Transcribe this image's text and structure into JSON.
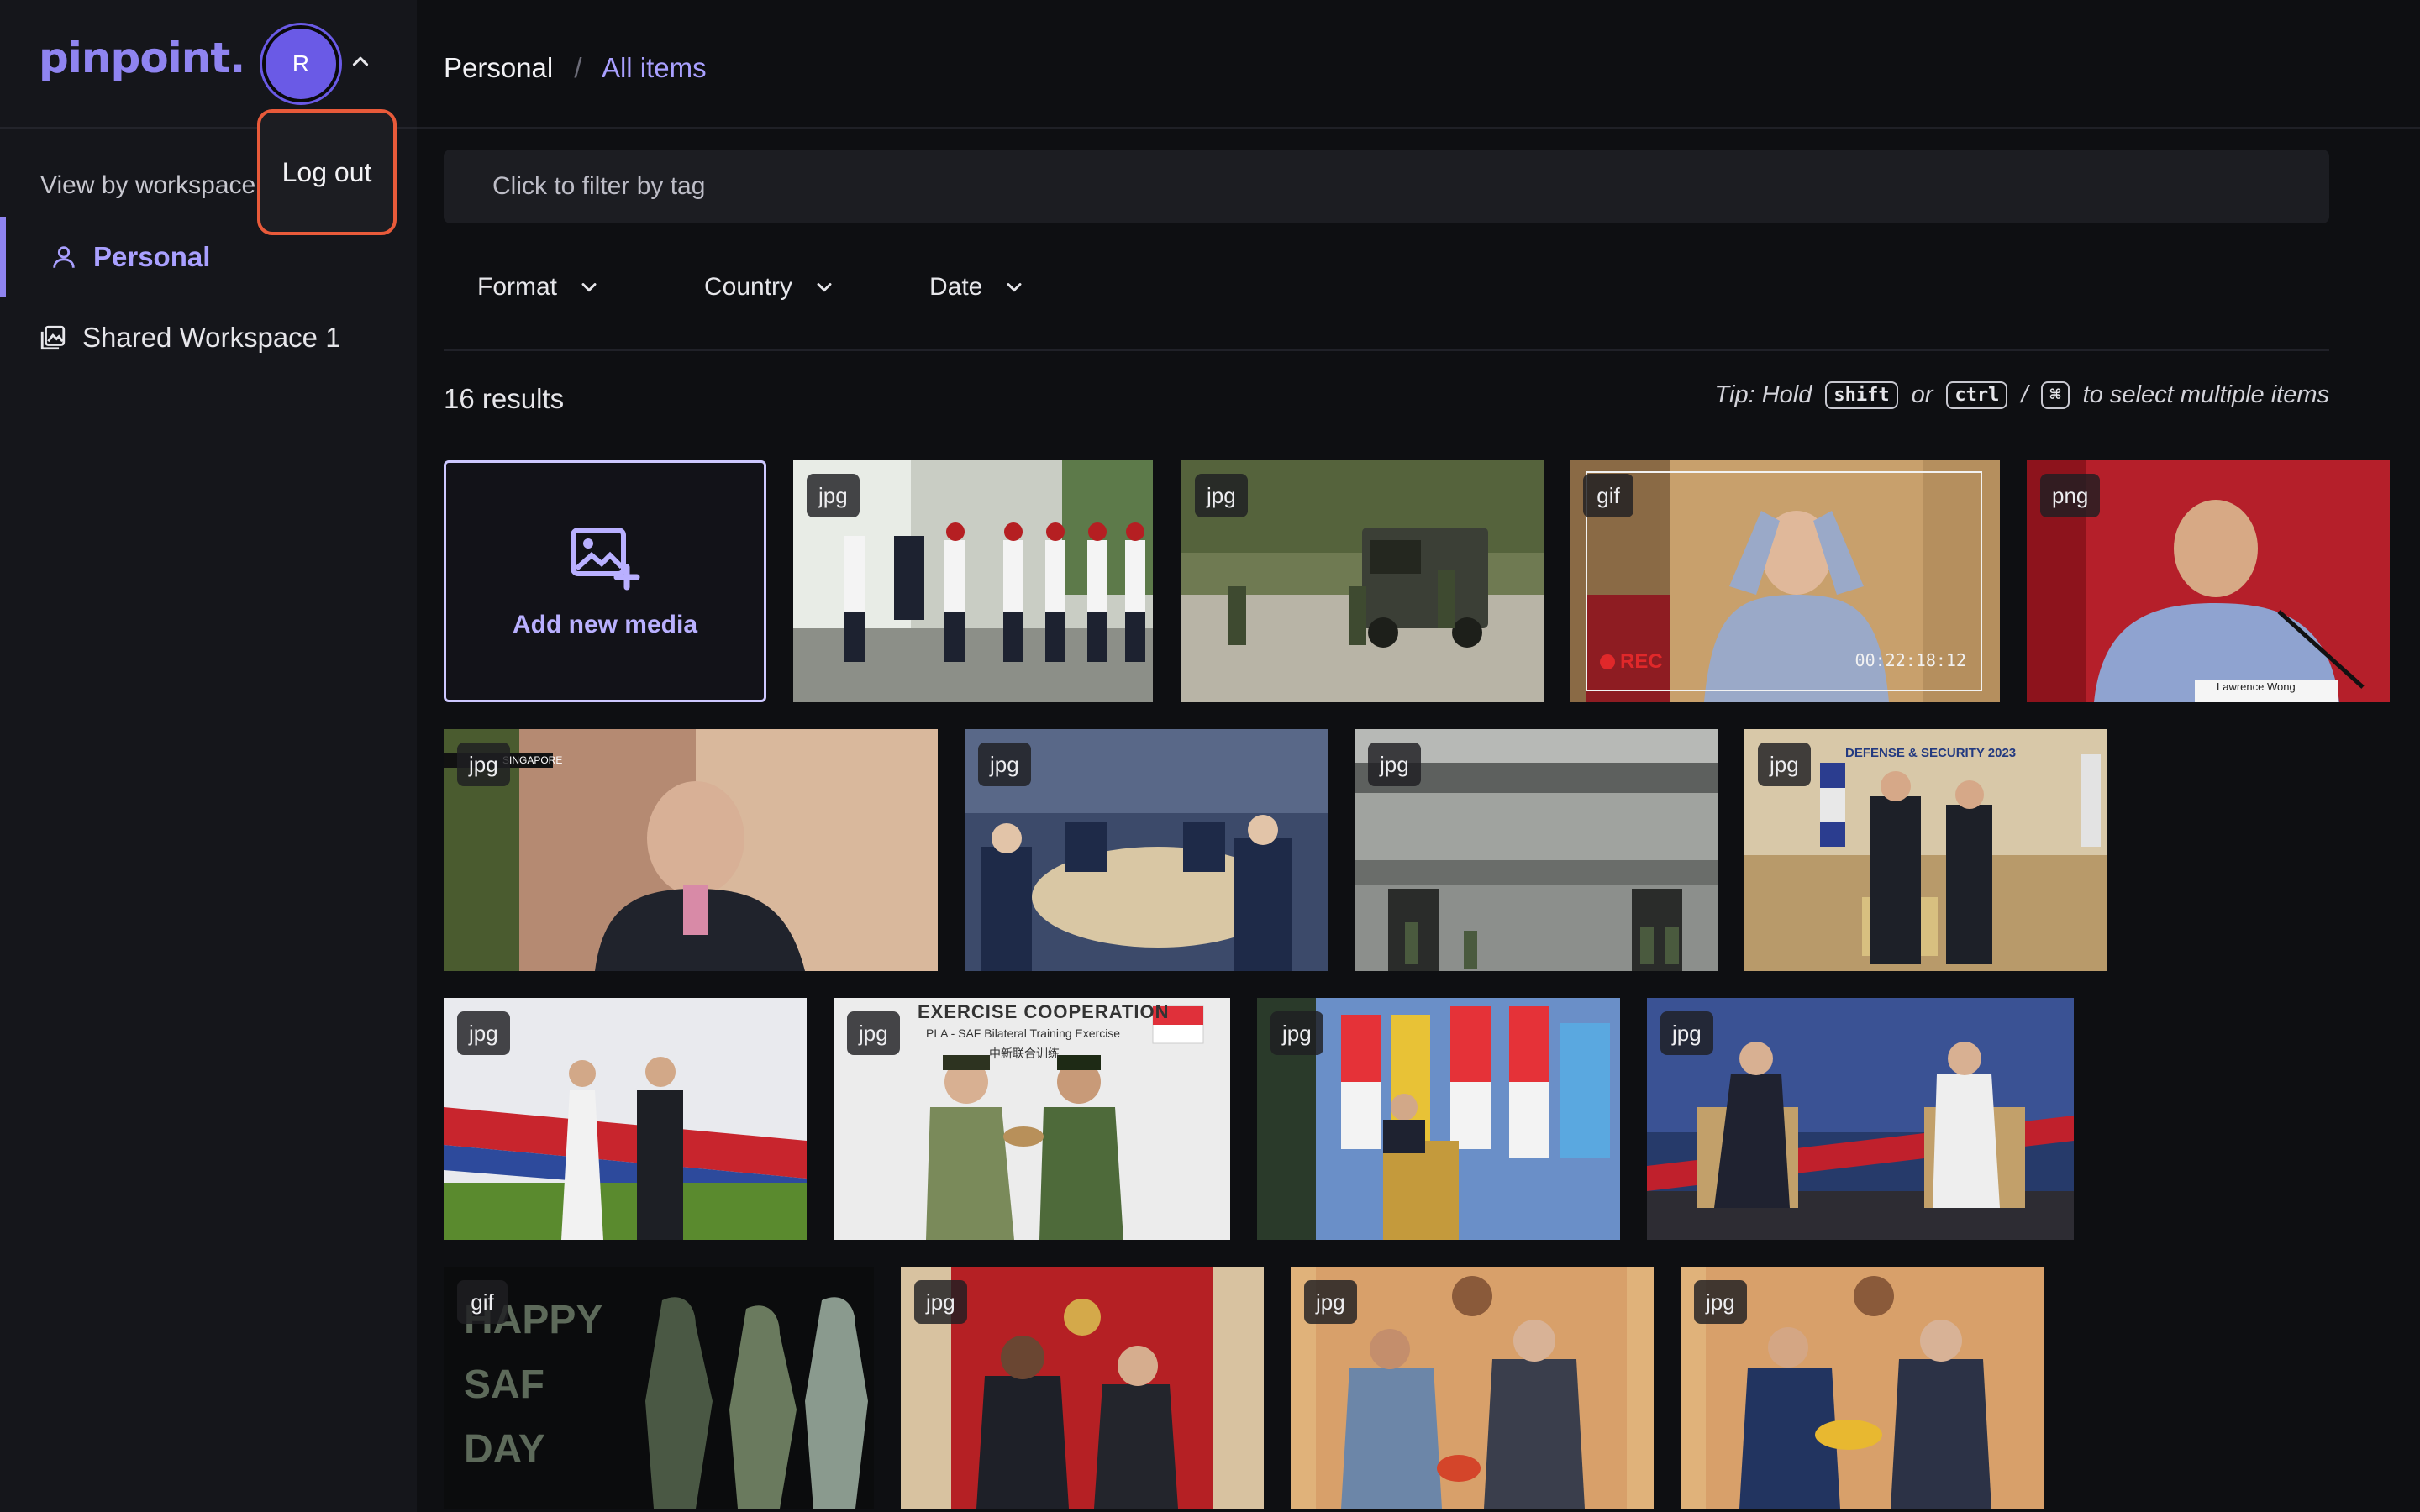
{
  "app": {
    "logo": "pinpoint."
  },
  "user": {
    "initial": "R"
  },
  "popover": {
    "logout_label": "Log out"
  },
  "sidebar": {
    "section_label": "View by workspace",
    "items": [
      {
        "label": "Personal",
        "icon": "user-icon",
        "active": true
      },
      {
        "label": "Shared Workspace 1",
        "icon": "gallery-icon",
        "active": false
      }
    ]
  },
  "breadcrumb": {
    "home": "Personal",
    "separator": "/",
    "current": "All items"
  },
  "tag_filter": {
    "placeholder": "Click to filter by tag"
  },
  "filters": [
    {
      "label": "Format"
    },
    {
      "label": "Country"
    },
    {
      "label": "Date"
    }
  ],
  "results": {
    "count_text": "16 results"
  },
  "tip": {
    "prefix": "Tip: Hold",
    "key1": "shift",
    "or": "or",
    "key2": "ctrl",
    "slash": "/",
    "key3": "⌘",
    "suffix": "to select multiple items"
  },
  "add_media": {
    "label": "Add new media"
  },
  "media": [
    {
      "format": "jpg",
      "description": "honour guard"
    },
    {
      "format": "jpg",
      "description": "soldiers and armoured vehicle"
    },
    {
      "format": "gif",
      "description": "man in blue shirt gesturing",
      "rec_label": "REC",
      "timecode": "00:22:18:12"
    },
    {
      "format": "png",
      "description": "man speaking at microphone",
      "nameplate": "Lawrence Wong"
    },
    {
      "format": "jpg",
      "description": "man drinking tea",
      "overlay_text": "SINGAPORE"
    },
    {
      "format": "jpg",
      "description": "banquet table"
    },
    {
      "format": "jpg",
      "description": "soldiers at building"
    },
    {
      "format": "jpg",
      "description": "handshake at defence event",
      "overlay_text": "DEFENSE & SECURITY 2023"
    },
    {
      "format": "jpg",
      "description": "award presentation"
    },
    {
      "format": "jpg",
      "description": "exercise cooperation handshake",
      "overlay_title": "EXERCISE COOPERATION",
      "overlay_sub": "PLA - SAF Bilateral Training Exercise",
      "overlay_cn": "中新联合训练"
    },
    {
      "format": "jpg",
      "description": "speaker at podium with flags"
    },
    {
      "format": "jpg",
      "description": "two men seated on stage"
    },
    {
      "format": "gif",
      "description": "Happy SAF Day graphic",
      "overlay_text": "HAPPY SAF DAY"
    },
    {
      "format": "jpg",
      "description": "handshake red backdrop"
    },
    {
      "format": "jpg",
      "description": "handshake with crest"
    },
    {
      "format": "jpg",
      "description": "handshake with crest 2"
    }
  ],
  "colors": {
    "accent": "#8f84f0",
    "highlight_border": "#e85a3a",
    "background": "#0e0f12"
  }
}
